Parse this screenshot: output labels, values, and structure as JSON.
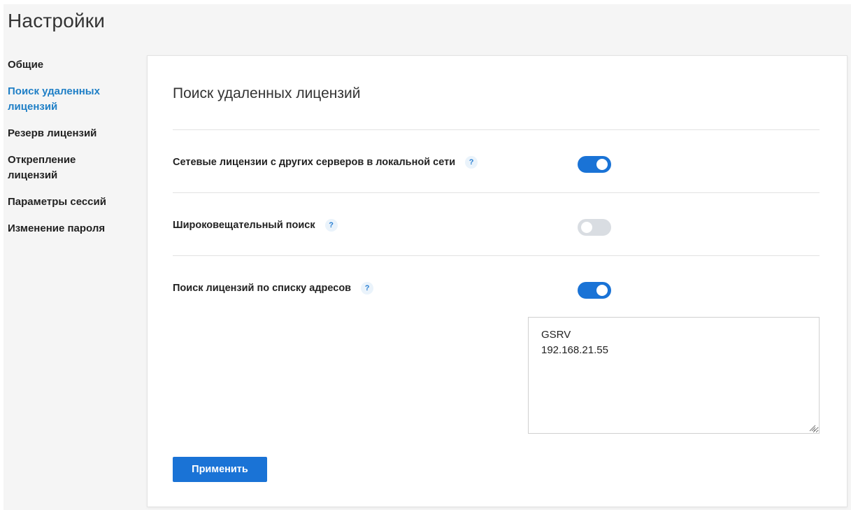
{
  "page": {
    "title": "Настройки"
  },
  "sidebar": {
    "items": [
      {
        "label": "Общие",
        "active": false
      },
      {
        "label": "Поиск удаленных лицензий",
        "active": true
      },
      {
        "label": "Резерв лицензий",
        "active": false
      },
      {
        "label": "Открепление лицензий",
        "active": false
      },
      {
        "label": "Параметры сессий",
        "active": false
      },
      {
        "label": "Изменение пароля",
        "active": false
      }
    ]
  },
  "section": {
    "title": "Поиск удаленных лицензий",
    "settings": [
      {
        "label": "Сетевые лицензии с других серверов в локальной сети",
        "enabled": true,
        "help": "?"
      },
      {
        "label": "Широковещательный поиск",
        "enabled": false,
        "help": "?"
      },
      {
        "label": "Поиск лицензий по списку адресов",
        "enabled": true,
        "help": "?"
      }
    ],
    "address_list": "GSRV\n192.168.21.55",
    "apply_label": "Применить"
  },
  "colors": {
    "accent": "#1a73d6",
    "active_link": "#1f7fc6",
    "toggle_off": "#d9dde2"
  }
}
